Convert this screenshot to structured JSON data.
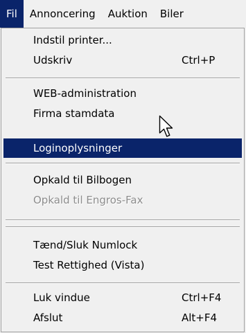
{
  "menubar": {
    "items": [
      "Fil",
      "Annoncering",
      "Auktion",
      "Biler"
    ]
  },
  "menu": {
    "items": [
      {
        "label": "Indstil printer...",
        "shortcut": ""
      },
      {
        "label": "Udskriv",
        "shortcut": "Ctrl+P"
      },
      {
        "label": "WEB-administration",
        "shortcut": ""
      },
      {
        "label": "Firma stamdata",
        "shortcut": ""
      },
      {
        "label": "Loginoplysninger",
        "shortcut": ""
      },
      {
        "label": "Opkald til Bilbogen",
        "shortcut": ""
      },
      {
        "label": "Opkald til Engros-Fax",
        "shortcut": ""
      },
      {
        "label": "Tænd/Sluk Numlock",
        "shortcut": ""
      },
      {
        "label": "Test Rettighed (Vista)",
        "shortcut": ""
      },
      {
        "label": "Luk vindue",
        "shortcut": "Ctrl+F4"
      },
      {
        "label": "Afslut",
        "shortcut": "Alt+F4"
      }
    ]
  },
  "colors": {
    "highlight": "#0a246a",
    "menu_background": "#f0f0f0",
    "disabled_text": "#8d8d8d"
  },
  "icons": {
    "cursor": "mouse-pointer-icon"
  }
}
